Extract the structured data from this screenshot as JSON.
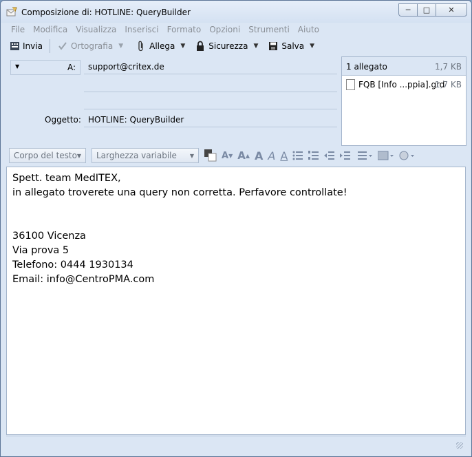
{
  "window": {
    "title": "Composizione di: HOTLINE: QueryBuilder",
    "buttons": {
      "minimize": "─",
      "maximize": "□",
      "close": "✕"
    }
  },
  "menu": [
    "File",
    "Modifica",
    "Visualizza",
    "Inserisci",
    "Formato",
    "Opzioni",
    "Strumenti",
    "Aiuto"
  ],
  "toolbar": {
    "send": "Invia",
    "spelling": "Ortografia",
    "attach": "Allega",
    "security": "Sicurezza",
    "save": "Salva"
  },
  "header": {
    "address_type": "A:",
    "to_value": "support@critex.de",
    "subject_label": "Oggetto:",
    "subject_value": "HOTLINE: QueryBuilder"
  },
  "attachments": {
    "count_label": "1 allegato",
    "total_size": "1,7 KB",
    "items": [
      {
        "name": "FQB [Info ...ppia].grd",
        "size": "1,7 KB"
      }
    ]
  },
  "format": {
    "paragraph_style": "Corpo del testo",
    "font": "Larghezza variabile"
  },
  "body": {
    "lines": [
      "Spett. team MedITEX,",
      "in allegato troverete una query non corretta. Perfavore controllate!",
      "36100 Vicenza",
      "Via prova 5",
      "Telefono: 0444 1930134",
      "Email: info@CentroPMA.com"
    ]
  },
  "colors": {
    "chrome": "#dbe6f4",
    "disabled_text": "#8a8f96",
    "border": "#a4b5cc"
  }
}
